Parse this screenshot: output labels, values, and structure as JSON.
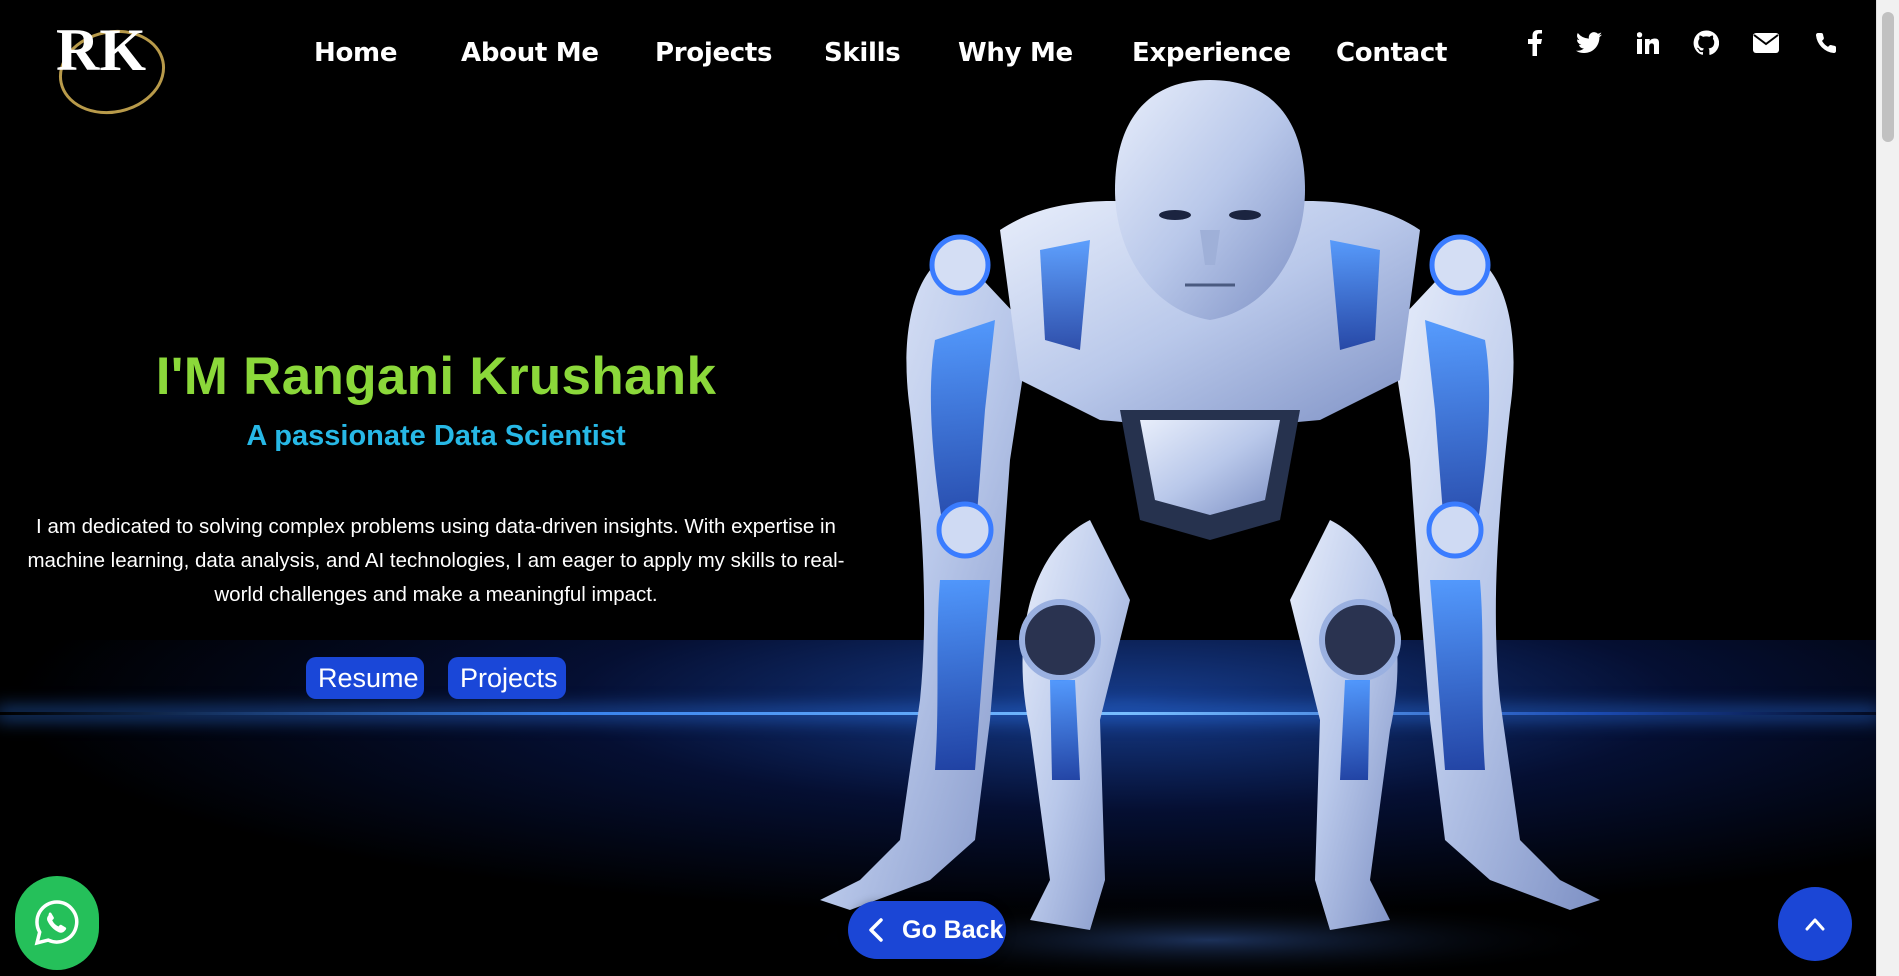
{
  "logo": {
    "text": "RK"
  },
  "nav": {
    "home": "Home",
    "about": "About Me",
    "projects": "Projects",
    "skills": "Skills",
    "why": "Why Me",
    "experience": "Experience",
    "contact": "Contact"
  },
  "social": [
    "facebook-icon",
    "twitter-icon",
    "linkedin-icon",
    "github-icon",
    "email-icon",
    "phone-icon"
  ],
  "hero": {
    "title": "I'M Rangani Krushank",
    "subtitle": "A passionate Data Scientist",
    "description": "I am dedicated to solving complex problems using data-driven insights. With expertise in machine learning, data analysis, and AI technologies, I am eager to apply my skills to real-world challenges and make a meaningful impact.",
    "resume_label": "Resume",
    "projects_label": "Projects"
  },
  "go_back_label": "Go Back",
  "colors": {
    "background": "#000000",
    "title": "#8bd83a",
    "subtitle": "#27b8e6",
    "button": "#1a47d8",
    "whatsapp": "#25c05a"
  }
}
